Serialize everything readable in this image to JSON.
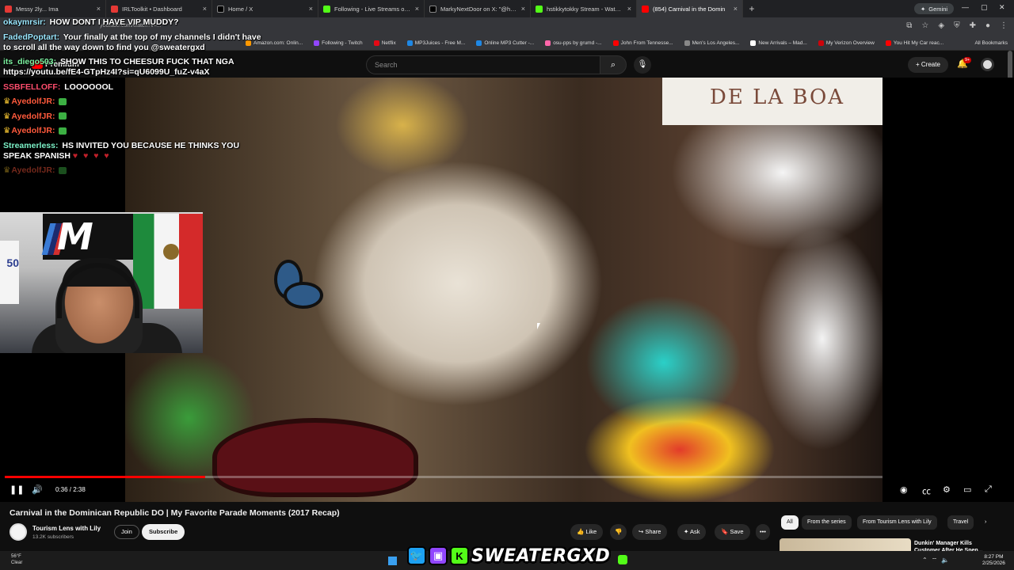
{
  "browser": {
    "tabs": [
      {
        "label": "Messy 2ly... Ima",
        "favicon_color": "#e53935"
      },
      {
        "label": "IRLToolkit • Dashboard",
        "favicon_color": "#e53935"
      },
      {
        "label": "Home / X",
        "favicon_color": "#000000"
      },
      {
        "label": "Following - Live Streams on Ki",
        "favicon_color": "#53fc18"
      },
      {
        "label": "MarkyNextDoor on X: \"@hion",
        "favicon_color": "#000000"
      },
      {
        "label": "hstikkytokky Stream - Watch Li",
        "favicon_color": "#53fc18"
      },
      {
        "label": "(854) Carnival in the Domin",
        "favicon_color": "#ff0000",
        "active": true
      }
    ],
    "new_tab": "+",
    "gemini": "Gemini",
    "url": "youtube.com/watch?v=...",
    "bookmarks": [
      {
        "label": "Amazon.com: Onlin...",
        "color": "#ff9900"
      },
      {
        "label": "Following - Twitch",
        "color": "#9146ff"
      },
      {
        "label": "Netflix",
        "color": "#e50914"
      },
      {
        "label": "MP3Juices - Free M...",
        "color": "#1e88e5"
      },
      {
        "label": "Online MP3 Cutter -...",
        "color": "#1e88e5"
      },
      {
        "label": "osu-pps by grumd -...",
        "color": "#ff66aa"
      },
      {
        "label": "John From Tennesse...",
        "color": "#ff0000"
      },
      {
        "label": "Men's Los Angeles...",
        "color": "#888888"
      },
      {
        "label": "New Arrivals – Mad...",
        "color": "#ffffff"
      },
      {
        "label": "My Verizon Overview",
        "color": "#cd040b"
      },
      {
        "label": "You Hit My Car reac...",
        "color": "#ff0000"
      }
    ],
    "all_bookmarks": "All Bookmarks"
  },
  "youtube": {
    "logo": "Premium",
    "search_placeholder": "Search",
    "create_label": "+ Create",
    "notif_count": "9+"
  },
  "chat": [
    {
      "user": "okaymrsir:",
      "user_color": "#9be7ff",
      "text": "HOW DONT I HAVE VIP MUDDY?"
    },
    {
      "user": "FadedPoptart:",
      "user_color": "#9be7ff",
      "text": "Your finally at the top of my channels I didn't have to scroll all the way down to find you @sweatergxd",
      "badge": true
    },
    {
      "user": "its_diego503:",
      "user_color": "#7cf2a0",
      "text": "SHOW THIS TO CHEESUR FUCK THAT NGA https://youtu.be/fE4-GTpHz4I?si=qU6099U_fuZ-v4aX"
    },
    {
      "user": "SSBFELLOFF:",
      "user_color": "#ff4d6d",
      "text": "LOOOOOOL"
    },
    {
      "user": "AyedolfJR:",
      "user_color": "#ff5a3c",
      "text": "",
      "crown": true,
      "emote": true
    },
    {
      "user": "AyedolfJR:",
      "user_color": "#ff5a3c",
      "text": "",
      "crown": true,
      "emote": true
    },
    {
      "user": "AyedolfJR:",
      "user_color": "#ff5a3c",
      "text": "",
      "crown": true,
      "emote": true
    },
    {
      "user": "Streamerless:",
      "user_color": "#7cf2c8",
      "text": "HS INVITED YOU BECAUSE HE THINKS YOU SPEAK SPANISH",
      "hearts": "♥ ♥ ♥ ♥"
    },
    {
      "user": "AyedolfJR:",
      "user_color": "#ff5a3c",
      "text": "",
      "crown": true,
      "emote": true,
      "faded": true
    }
  ],
  "webcam": {
    "jersey_number": "50",
    "logo_letter": "M"
  },
  "video": {
    "sign_text": "DE LA BOA",
    "time_current": "0:36",
    "time_total": "2:38",
    "progress": 0.228
  },
  "meta": {
    "title": "Carnival in the Dominican Republic DO | My Favorite Parade Moments (2017 Recap)",
    "channel": "Tourism Lens with Lily",
    "subscribers": "13.2K subscribers",
    "join": "Join",
    "subscribe": "Subscribe",
    "like": "Like",
    "share": "Share",
    "ask": "Ask",
    "save": "Save",
    "more": "•••"
  },
  "chips": [
    "All",
    "From the series",
    "From Tourism Lens with Lily",
    "Travel"
  ],
  "recommended": {
    "title": "Dunkin' Manager Kills Customer After He Spen..."
  },
  "taskbar": {
    "temp": "56°F",
    "weather": "Clear",
    "time": "8:27 PM",
    "date": "2/25/2026"
  },
  "banner": {
    "handle": "SWEATERGXD"
  }
}
